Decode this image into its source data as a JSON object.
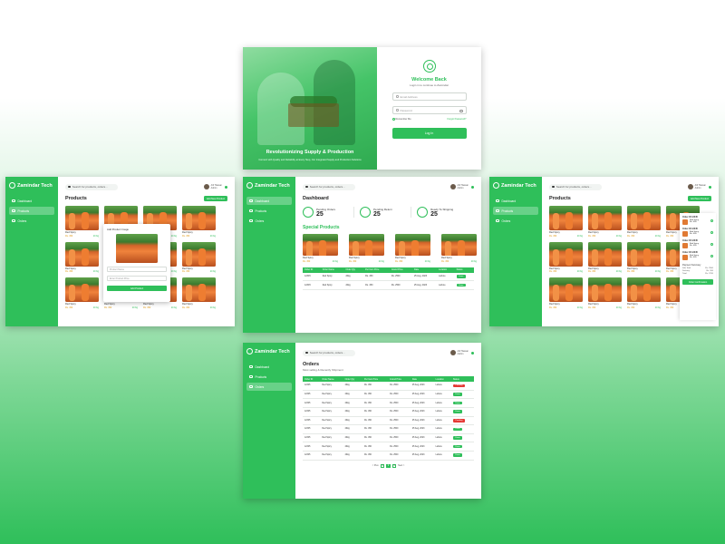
{
  "brand": "Zamindar Tech",
  "login": {
    "hero_caption": "Revolutionizing Supply & Production",
    "hero_subcaption": "Connect with Quality and Reliability at Every Step, Our Integrated Supply and Production Solutions",
    "welcome": "Welcome Back",
    "welcome_sub": "Login in to continue to Zamindar",
    "email_placeholder": "Email Address",
    "password_placeholder": "Password",
    "remember": "Remember Me",
    "forgot": "Forgot Password?",
    "login_button": "Log In"
  },
  "nav": {
    "dashboard": "Dashboard",
    "products": "Products",
    "orders": "Orders"
  },
  "search_placeholder": "Search for products, orders...",
  "user": {
    "name": "Arif Hassan",
    "role": "Admin"
  },
  "products": {
    "title": "Products",
    "add_button": "Add New Product",
    "item_name": "Red Spicy",
    "item_price": "Rs. 450",
    "item_qty": "20 Kg"
  },
  "modal": {
    "title": "Add Product Image",
    "name_placeholder": "Product Name",
    "price_placeholder": "Enter Product Price",
    "button": "Add Product"
  },
  "dashboard": {
    "title": "Dashboard",
    "stats": [
      {
        "label": "Pending Orders",
        "value": "25"
      },
      {
        "label": "Pending Return",
        "value": "25"
      },
      {
        "label": "Ready To Shipping",
        "value": "25"
      }
    ],
    "special_prefix": "Special",
    "special_suffix": "Products",
    "table_headers": [
      "Order ID",
      "Order Name",
      "Order Qty",
      "Per Item Price",
      "Grand Price",
      "Date",
      "Location",
      "Status"
    ],
    "rows": [
      [
        "12345",
        "Red Spicy",
        "20kg",
        "Rs. 450",
        "Rs. 2500",
        "25 Aug, 2023",
        "Lahore",
        "Done"
      ],
      [
        "12345",
        "Red Spicy",
        "20kg",
        "Rs. 450",
        "Rs. 2500",
        "25 Aug, 2023",
        "Lahore",
        "Done"
      ]
    ]
  },
  "orders_panel": {
    "items": [
      {
        "title": "Order ID 12345",
        "name": "Red Spicy",
        "price": "Rs. 450"
      },
      {
        "title": "Order ID 12345",
        "name": "Red Spicy",
        "price": "Rs. 450"
      },
      {
        "title": "Order ID 12345",
        "name": "Red Spicy",
        "price": "Rs. 450"
      },
      {
        "title": "Order ID 12345",
        "name": "Red Spicy",
        "price": "Rs. 450"
      }
    ],
    "summary_title": "Payment Summary",
    "summary": [
      {
        "label": "Sub Total",
        "value": "Rs. 2500"
      },
      {
        "label": "Delivery",
        "value": "Rs. 200"
      },
      {
        "label": "Total",
        "value": "Rs. 2700"
      }
    ],
    "button": "Order Confirmation"
  },
  "orders": {
    "title": "Orders",
    "subtitle": "Most selling & Recently Shipment",
    "table_headers": [
      "Order ID",
      "Order Name",
      "Order Qty",
      "Per Item Price",
      "Grand Price",
      "Date",
      "Location",
      "Status"
    ],
    "rows": [
      [
        "12345",
        "Red Spicy",
        "20kg",
        "Rs. 450",
        "Rs. 2500",
        "25 Aug, 2023",
        "Lahore",
        "Pending"
      ],
      [
        "12345",
        "Red Spicy",
        "20kg",
        "Rs. 450",
        "Rs. 2500",
        "25 Aug, 2023",
        "Lahore",
        "Done"
      ],
      [
        "12345",
        "Red Spicy",
        "20kg",
        "Rs. 450",
        "Rs. 2500",
        "25 Aug, 2023",
        "Lahore",
        "Done"
      ],
      [
        "12345",
        "Red Spicy",
        "20kg",
        "Rs. 450",
        "Rs. 2500",
        "25 Aug, 2023",
        "Lahore",
        "Done"
      ],
      [
        "12345",
        "Red Spicy",
        "20kg",
        "Rs. 450",
        "Rs. 2500",
        "25 Aug, 2023",
        "Lahore",
        "Pending"
      ],
      [
        "12345",
        "Red Spicy",
        "20kg",
        "Rs. 450",
        "Rs. 2500",
        "25 Aug, 2023",
        "Lahore",
        "Done"
      ],
      [
        "12345",
        "Red Spicy",
        "20kg",
        "Rs. 450",
        "Rs. 2500",
        "25 Aug, 2023",
        "Lahore",
        "Done"
      ],
      [
        "12345",
        "Red Spicy",
        "20kg",
        "Rs. 450",
        "Rs. 2500",
        "25 Aug, 2023",
        "Lahore",
        "Done"
      ],
      [
        "12345",
        "Red Spicy",
        "20kg",
        "Rs. 450",
        "Rs. 2500",
        "25 Aug, 2023",
        "Lahore",
        "Done"
      ]
    ],
    "pager_prev": "< Prev",
    "pager_next": "Next >",
    "pages": [
      "1",
      "2",
      "3"
    ],
    "current_page": "2"
  },
  "colors": {
    "accent": "#2fbf5a",
    "danger": "#e53935",
    "price": "#e09a17"
  }
}
